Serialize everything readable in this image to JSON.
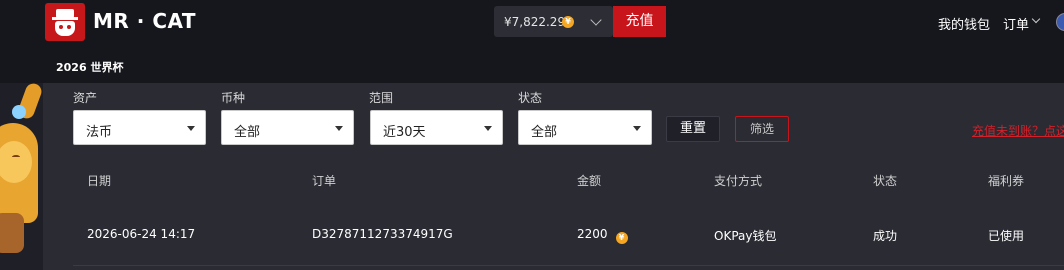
{
  "header": {
    "brand": "MR · CAT",
    "balance": "¥7,822.29",
    "balance_coin_icon": "coin-icon",
    "recharge_label": "充值",
    "nav_wallet": "我的钱包",
    "nav_orders": "订单"
  },
  "subbar": {
    "title": "2026 世界杯"
  },
  "filters": {
    "asset": {
      "label": "资产",
      "value": "法币"
    },
    "currency": {
      "label": "币种",
      "value": "全部"
    },
    "range": {
      "label": "范围",
      "value": "近30天"
    },
    "status": {
      "label": "状态",
      "value": "全部"
    },
    "reset_label": "重置",
    "filter_label": "筛选",
    "hint": "充值未到账？点这"
  },
  "table": {
    "headers": [
      "日期",
      "订单",
      "金额",
      "支付方式",
      "状态",
      "福利券"
    ],
    "rows": [
      {
        "date": "2026-06-24 14:17",
        "order": "D3278711273374917G",
        "amount": "2200",
        "payment": "OKPay钱包",
        "status": "成功",
        "coupon": "已使用"
      }
    ]
  },
  "colors": {
    "accent": "#c8141b",
    "coin": "#f5a623",
    "background": "#1f2027",
    "panel": "#2a2b33"
  }
}
